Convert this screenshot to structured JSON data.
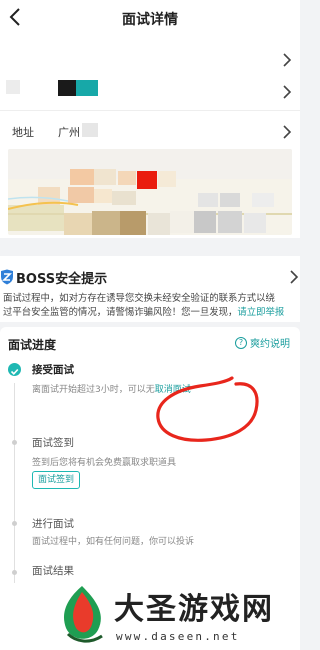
{
  "header": {
    "title": "面试详情"
  },
  "job": {
    "address_label": "地址",
    "address_value": "广州"
  },
  "safety": {
    "title": "BOSS安全提示",
    "line1": "面试过程中，如对方存在诱导您交换未经安全验证的联系方式以绕",
    "line2": "过平台安全监管的情况，请警惕诈骗风险！您一旦发现，",
    "link": "请立即举报"
  },
  "progress": {
    "title": "面试进度",
    "policy_label": "爽约说明",
    "steps": [
      {
        "title": "接受面试",
        "desc": "离面试开始超过3小时，可以无",
        "action": "取消面试"
      },
      {
        "title": "面试签到",
        "desc": "签到后您将有机会免费赢取求职道具",
        "button": "面试签到"
      },
      {
        "title": "进行面试",
        "desc": "面试过程中，如有任何问题，你可以投诉"
      },
      {
        "title": "面试结果"
      }
    ]
  },
  "watermark": {
    "name": "大圣游戏网",
    "url": "www.daseen.net"
  },
  "colors": {
    "accent": "#1fb8b3",
    "link": "#1b9e9e",
    "annotation": "#e8261c"
  }
}
